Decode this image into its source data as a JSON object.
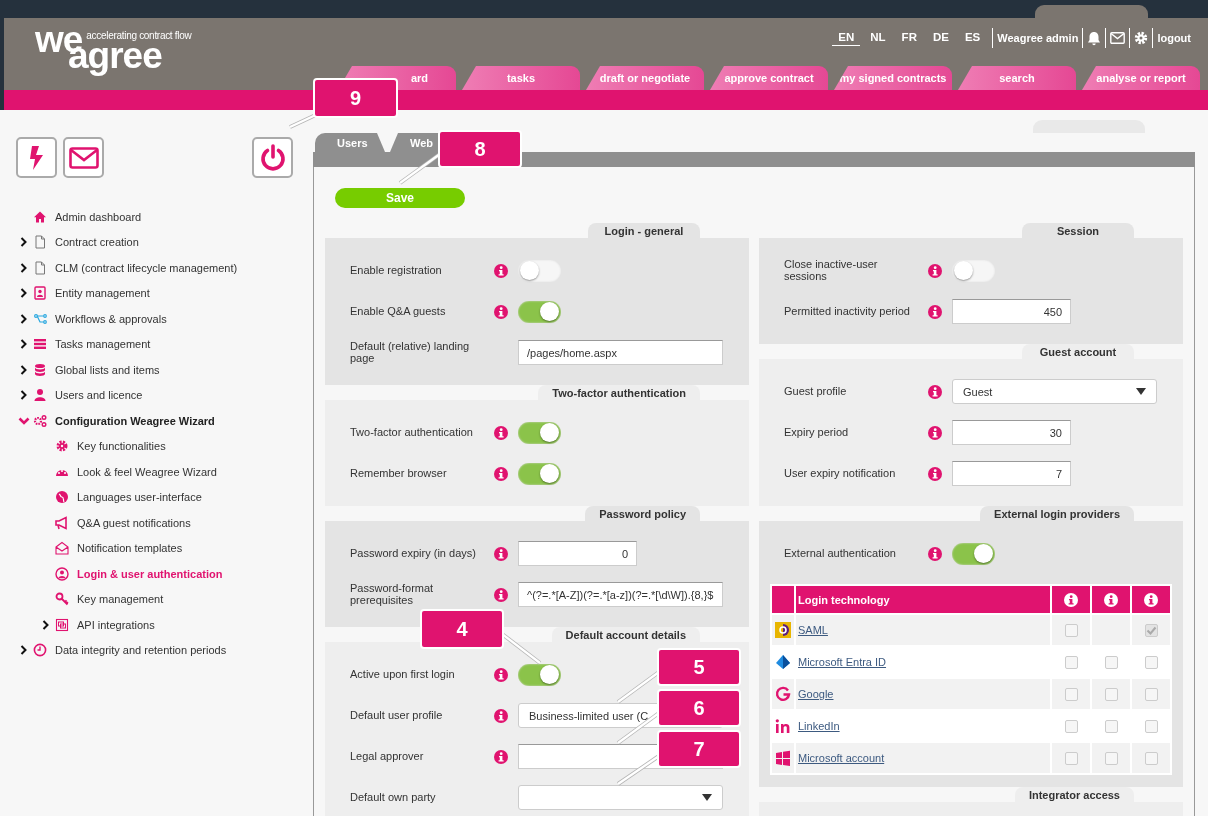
{
  "header": {
    "logo": {
      "top": "we",
      "bottom": "agree",
      "tagline": "accelerating contract flow"
    },
    "languages": [
      {
        "code": "EN",
        "selected": true
      },
      {
        "code": "NL",
        "selected": false
      },
      {
        "code": "FR",
        "selected": false
      },
      {
        "code": "DE",
        "selected": false
      },
      {
        "code": "ES",
        "selected": false
      }
    ],
    "user": "Weagree admin",
    "logout": "logout",
    "nav_tabs": [
      {
        "label": "ard"
      },
      {
        "label": "tasks"
      },
      {
        "label": "draft or negotiate"
      },
      {
        "label": "approve contract"
      },
      {
        "label": "my signed contracts"
      },
      {
        "label": "search"
      },
      {
        "label": "analyse or report"
      }
    ]
  },
  "sidebar": {
    "menu": [
      {
        "label": "Admin dashboard",
        "kind": "link",
        "selected": false
      },
      {
        "label": "Contract creation",
        "kind": "folder",
        "expanded": false,
        "selected": false
      },
      {
        "label": "CLM (contract lifecycle management)",
        "kind": "folder",
        "expanded": false,
        "selected": false
      },
      {
        "label": "Entity management",
        "kind": "folder",
        "expanded": false,
        "selected": false
      },
      {
        "label": "Workflows & approvals",
        "kind": "folder",
        "expanded": false,
        "selected": false
      },
      {
        "label": "Tasks management",
        "kind": "folder",
        "expanded": false,
        "selected": false
      },
      {
        "label": "Global lists and items",
        "kind": "folder",
        "expanded": false,
        "selected": false
      },
      {
        "label": "Users and licence",
        "kind": "folder",
        "expanded": false,
        "selected": false
      },
      {
        "label": "Configuration Weagree Wizard",
        "kind": "folder",
        "expanded": true,
        "selected": false,
        "children": [
          {
            "label": "Key functionalities",
            "kind": "link",
            "selected": false
          },
          {
            "label": "Look & feel Weagree Wizard",
            "kind": "link",
            "selected": false
          },
          {
            "label": "Languages user-interface",
            "kind": "link",
            "selected": false
          },
          {
            "label": "Q&A guest notifications",
            "kind": "link",
            "selected": false
          },
          {
            "label": "Notification templates",
            "kind": "link",
            "selected": false
          },
          {
            "label": "Login & user authentication",
            "kind": "link",
            "selected": true
          },
          {
            "label": "Key management",
            "kind": "link",
            "selected": false
          },
          {
            "label": "API integrations",
            "kind": "folder",
            "expanded": false,
            "selected": false
          }
        ]
      },
      {
        "label": "Data integrity and retention periods",
        "kind": "folder",
        "expanded": false,
        "selected": false
      }
    ]
  },
  "panel": {
    "tabs": [
      {
        "label": "Users"
      },
      {
        "label": "Web"
      }
    ],
    "save": "Save",
    "columns": [
      {
        "sections": [
          {
            "title": "Login - general",
            "rows": [
              {
                "kind": "toggle",
                "label": "Enable registration",
                "info": true,
                "on": false
              },
              {
                "kind": "toggle",
                "label": "Enable Q&A guests",
                "info": true,
                "on": true
              },
              {
                "kind": "text",
                "label": "Default (relative) landing page",
                "info": false,
                "value": "/pages/home.aspx"
              }
            ]
          },
          {
            "title": "Two-factor authentication",
            "rows": [
              {
                "kind": "toggle",
                "label": "Two-factor authentication",
                "info": true,
                "on": true
              },
              {
                "kind": "toggle",
                "label": "Remember browser",
                "info": true,
                "on": true
              }
            ]
          },
          {
            "title": "Password policy",
            "rows": [
              {
                "kind": "number",
                "label": "Password expiry (in days)",
                "info": true,
                "value": "0"
              },
              {
                "kind": "text",
                "label": "Password-format prerequisites",
                "info": true,
                "value": "^(?=.*[A-Z])(?=.*[a-z])(?=.*[\\d\\W]).{8,}$"
              }
            ]
          },
          {
            "title": "Default account details",
            "rows": [
              {
                "kind": "toggle",
                "label": "Active upon first login",
                "info": true,
                "on": true
              },
              {
                "kind": "select",
                "label": "Default user profile",
                "info": true,
                "value": "Business-limited user (C",
                "caret_visible": false
              },
              {
                "kind": "text",
                "label": "Legal approver",
                "info": true
              },
              {
                "kind": "select",
                "label": "Default own party",
                "info": false,
                "caret_visible": true
              }
            ]
          }
        ]
      },
      {
        "sections": [
          {
            "title": "Session",
            "rows": [
              {
                "kind": "toggle",
                "label": "Close inactive-user sessions",
                "info": true,
                "on": false
              },
              {
                "kind": "number",
                "label": "Permitted inactivity period",
                "info": true,
                "value": "450"
              }
            ]
          },
          {
            "title": "Guest account",
            "rows": [
              {
                "kind": "select",
                "label": "Guest profile",
                "info": true,
                "value": "Guest",
                "caret_visible": true
              },
              {
                "kind": "number",
                "label": "Expiry period",
                "info": true,
                "value": "30"
              },
              {
                "kind": "number",
                "label": "User expiry notification",
                "info": true,
                "value": "7"
              }
            ]
          },
          {
            "title": "External login providers",
            "rows": [
              {
                "kind": "toggle",
                "label": "External authentication",
                "info": true,
                "on": true
              }
            ],
            "table": {
              "header": "Login technology",
              "rows": [
                {
                  "name": "SAML",
                  "checks": [
                    {
                      "kind": "checkbox",
                      "checked": false
                    },
                    {
                      "kind": "none"
                    },
                    {
                      "kind": "checkbox",
                      "checked": true
                    }
                  ]
                },
                {
                  "name": "Microsoft Entra ID",
                  "checks": [
                    {
                      "kind": "checkbox",
                      "checked": false
                    },
                    {
                      "kind": "checkbox",
                      "checked": false
                    },
                    {
                      "kind": "checkbox",
                      "checked": false
                    }
                  ]
                },
                {
                  "name": "Google",
                  "checks": [
                    {
                      "kind": "checkbox",
                      "checked": false
                    },
                    {
                      "kind": "checkbox",
                      "checked": false
                    },
                    {
                      "kind": "checkbox",
                      "checked": false
                    }
                  ]
                },
                {
                  "name": "LinkedIn",
                  "checks": [
                    {
                      "kind": "checkbox",
                      "checked": false
                    },
                    {
                      "kind": "checkbox",
                      "checked": false
                    },
                    {
                      "kind": "checkbox",
                      "checked": false
                    }
                  ]
                },
                {
                  "name": "Microsoft account",
                  "checks": [
                    {
                      "kind": "checkbox",
                      "checked": false
                    },
                    {
                      "kind": "checkbox",
                      "checked": false
                    },
                    {
                      "kind": "checkbox",
                      "checked": false
                    }
                  ]
                }
              ]
            }
          },
          {
            "title": "Integrator access"
          }
        ]
      }
    ]
  },
  "callouts": [
    {
      "number": "9"
    },
    {
      "number": "8"
    },
    {
      "number": "4"
    },
    {
      "number": "5"
    },
    {
      "number": "6"
    },
    {
      "number": "7"
    }
  ]
}
